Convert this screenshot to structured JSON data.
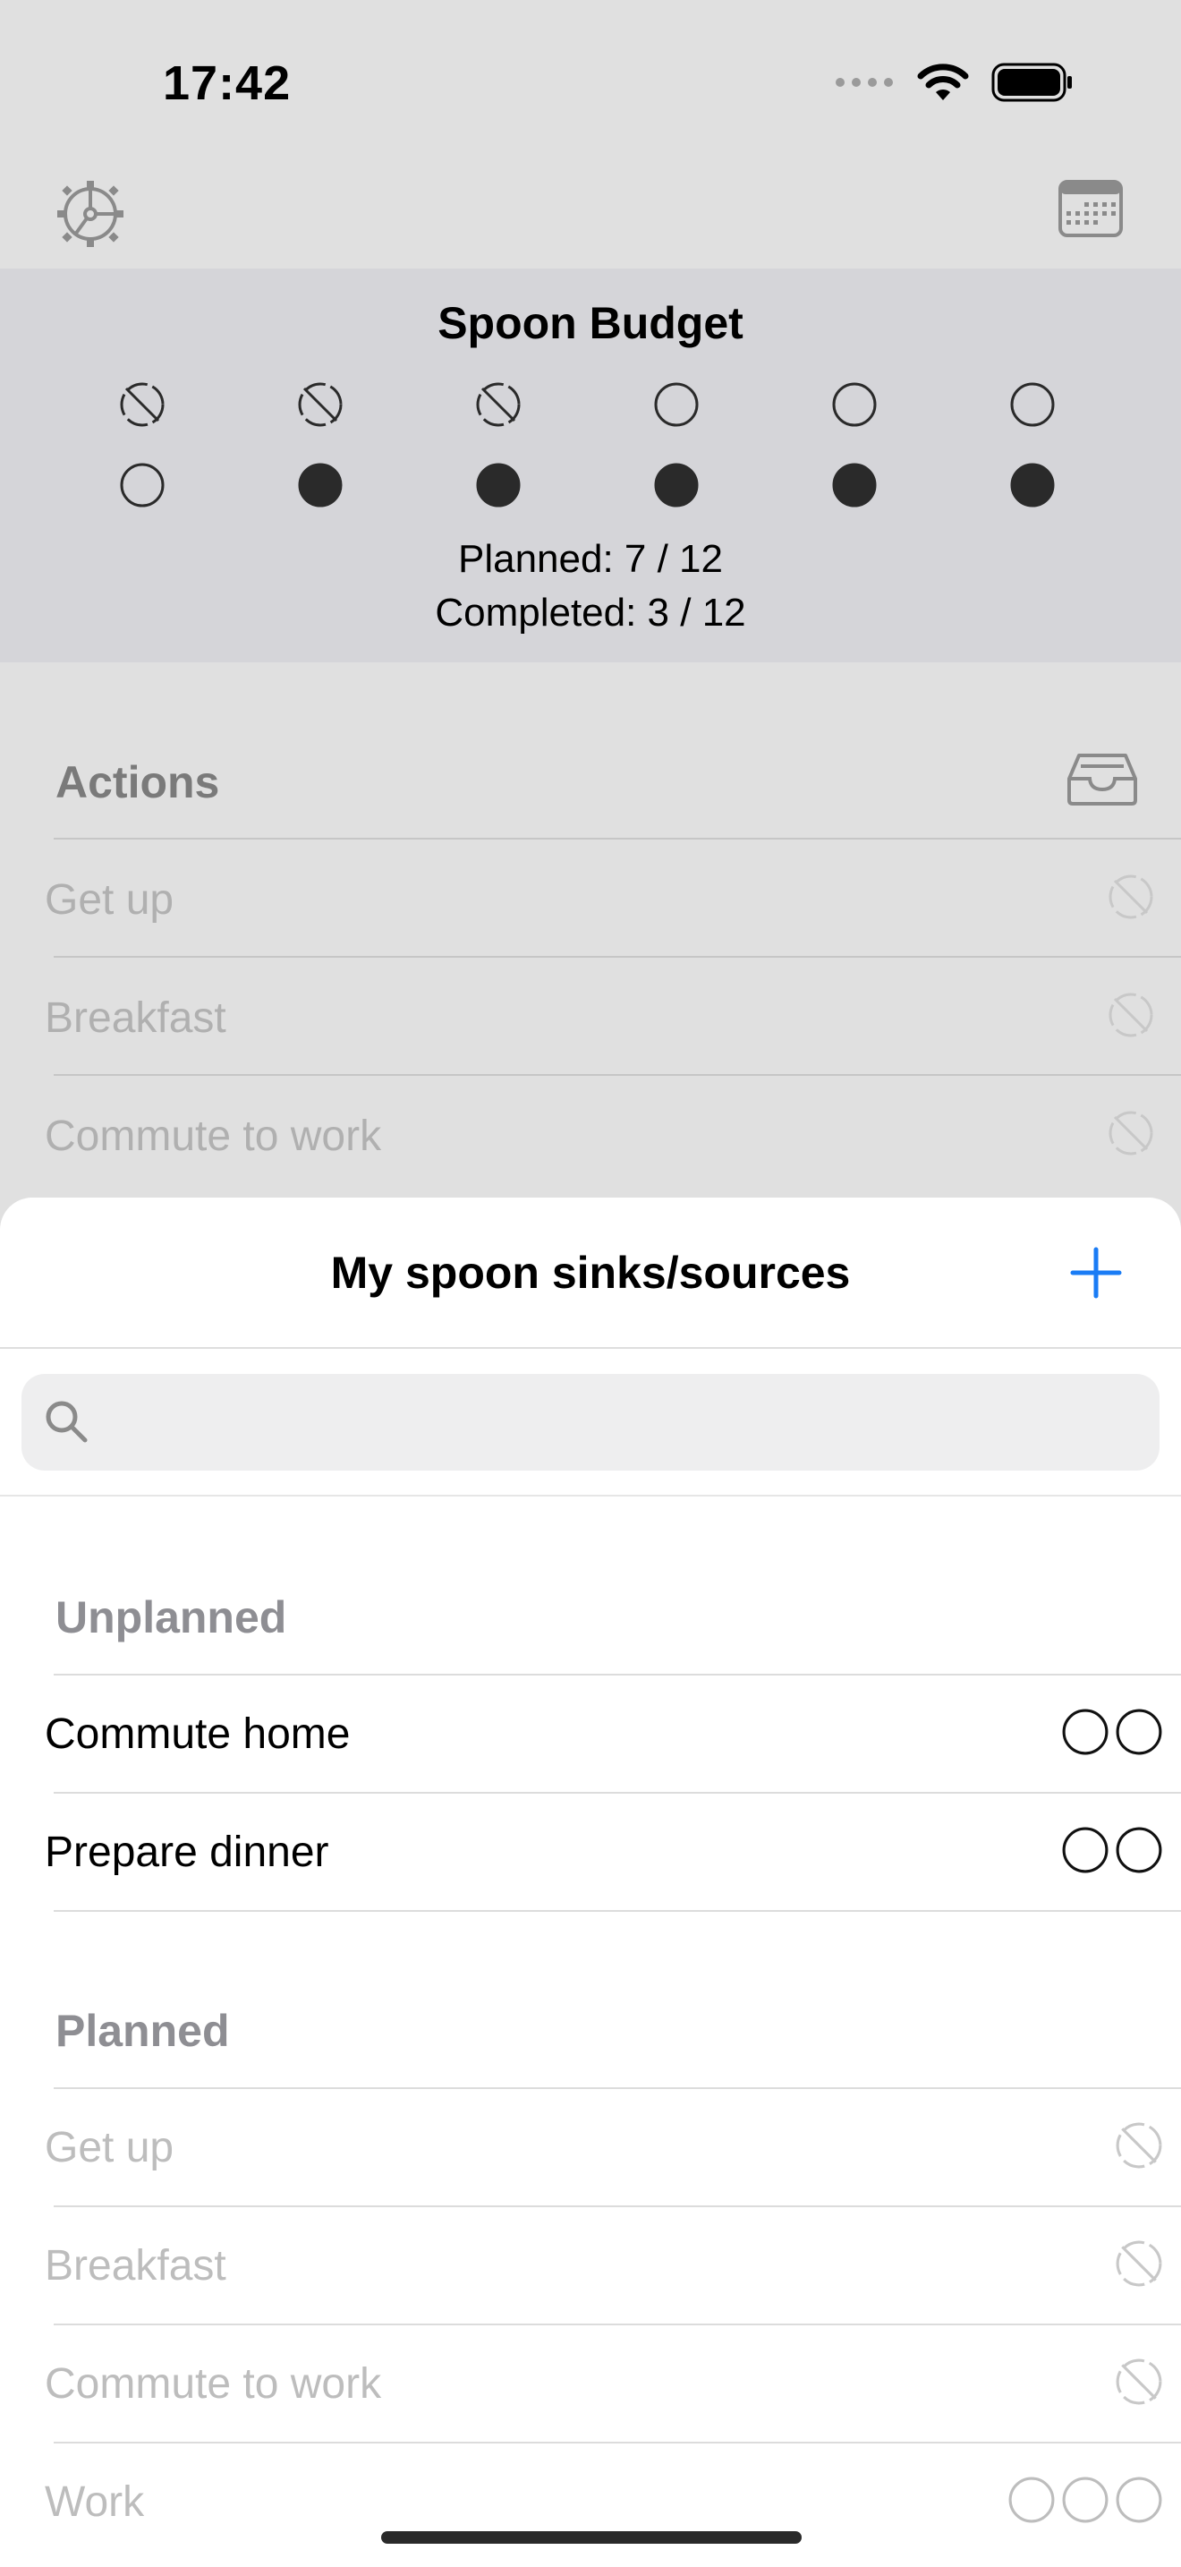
{
  "status_bar": {
    "time": "17:42"
  },
  "toolbar": {
    "settings_icon": "gear-icon",
    "calendar_icon": "calendar-icon"
  },
  "budget": {
    "title": "Spoon Budget",
    "planned_text": "Planned: 7 / 12",
    "completed_text": "Completed: 3 / 12",
    "spoons_row1": [
      "slashed",
      "slashed",
      "slashed",
      "empty",
      "empty",
      "empty"
    ],
    "spoons_row2": [
      "empty",
      "filled",
      "filled",
      "filled",
      "filled",
      "filled"
    ]
  },
  "actions": {
    "header": "Actions",
    "inbox_icon": "tray-icon",
    "items": [
      {
        "label": "Get up"
      },
      {
        "label": "Breakfast"
      },
      {
        "label": "Commute to work"
      }
    ]
  },
  "sheet": {
    "title": "My spoon sinks/sources",
    "add_icon": "plus-icon",
    "search": {
      "placeholder": "",
      "value": ""
    },
    "sections": {
      "unplanned": {
        "header": "Unplanned",
        "items": [
          {
            "label": "Commute home",
            "spoons": 2
          },
          {
            "label": "Prepare dinner",
            "spoons": 2
          }
        ]
      },
      "planned": {
        "header": "Planned",
        "items": [
          {
            "label": "Get up",
            "icon": "slashed"
          },
          {
            "label": "Breakfast",
            "icon": "slashed"
          },
          {
            "label": "Commute to work",
            "icon": "slashed"
          },
          {
            "label": "Work",
            "spoons": 3
          }
        ]
      }
    }
  },
  "colors": {
    "accent": "#1a7cf5",
    "panel": "#d5d5d9",
    "dim_text": "#b0b0b0"
  }
}
